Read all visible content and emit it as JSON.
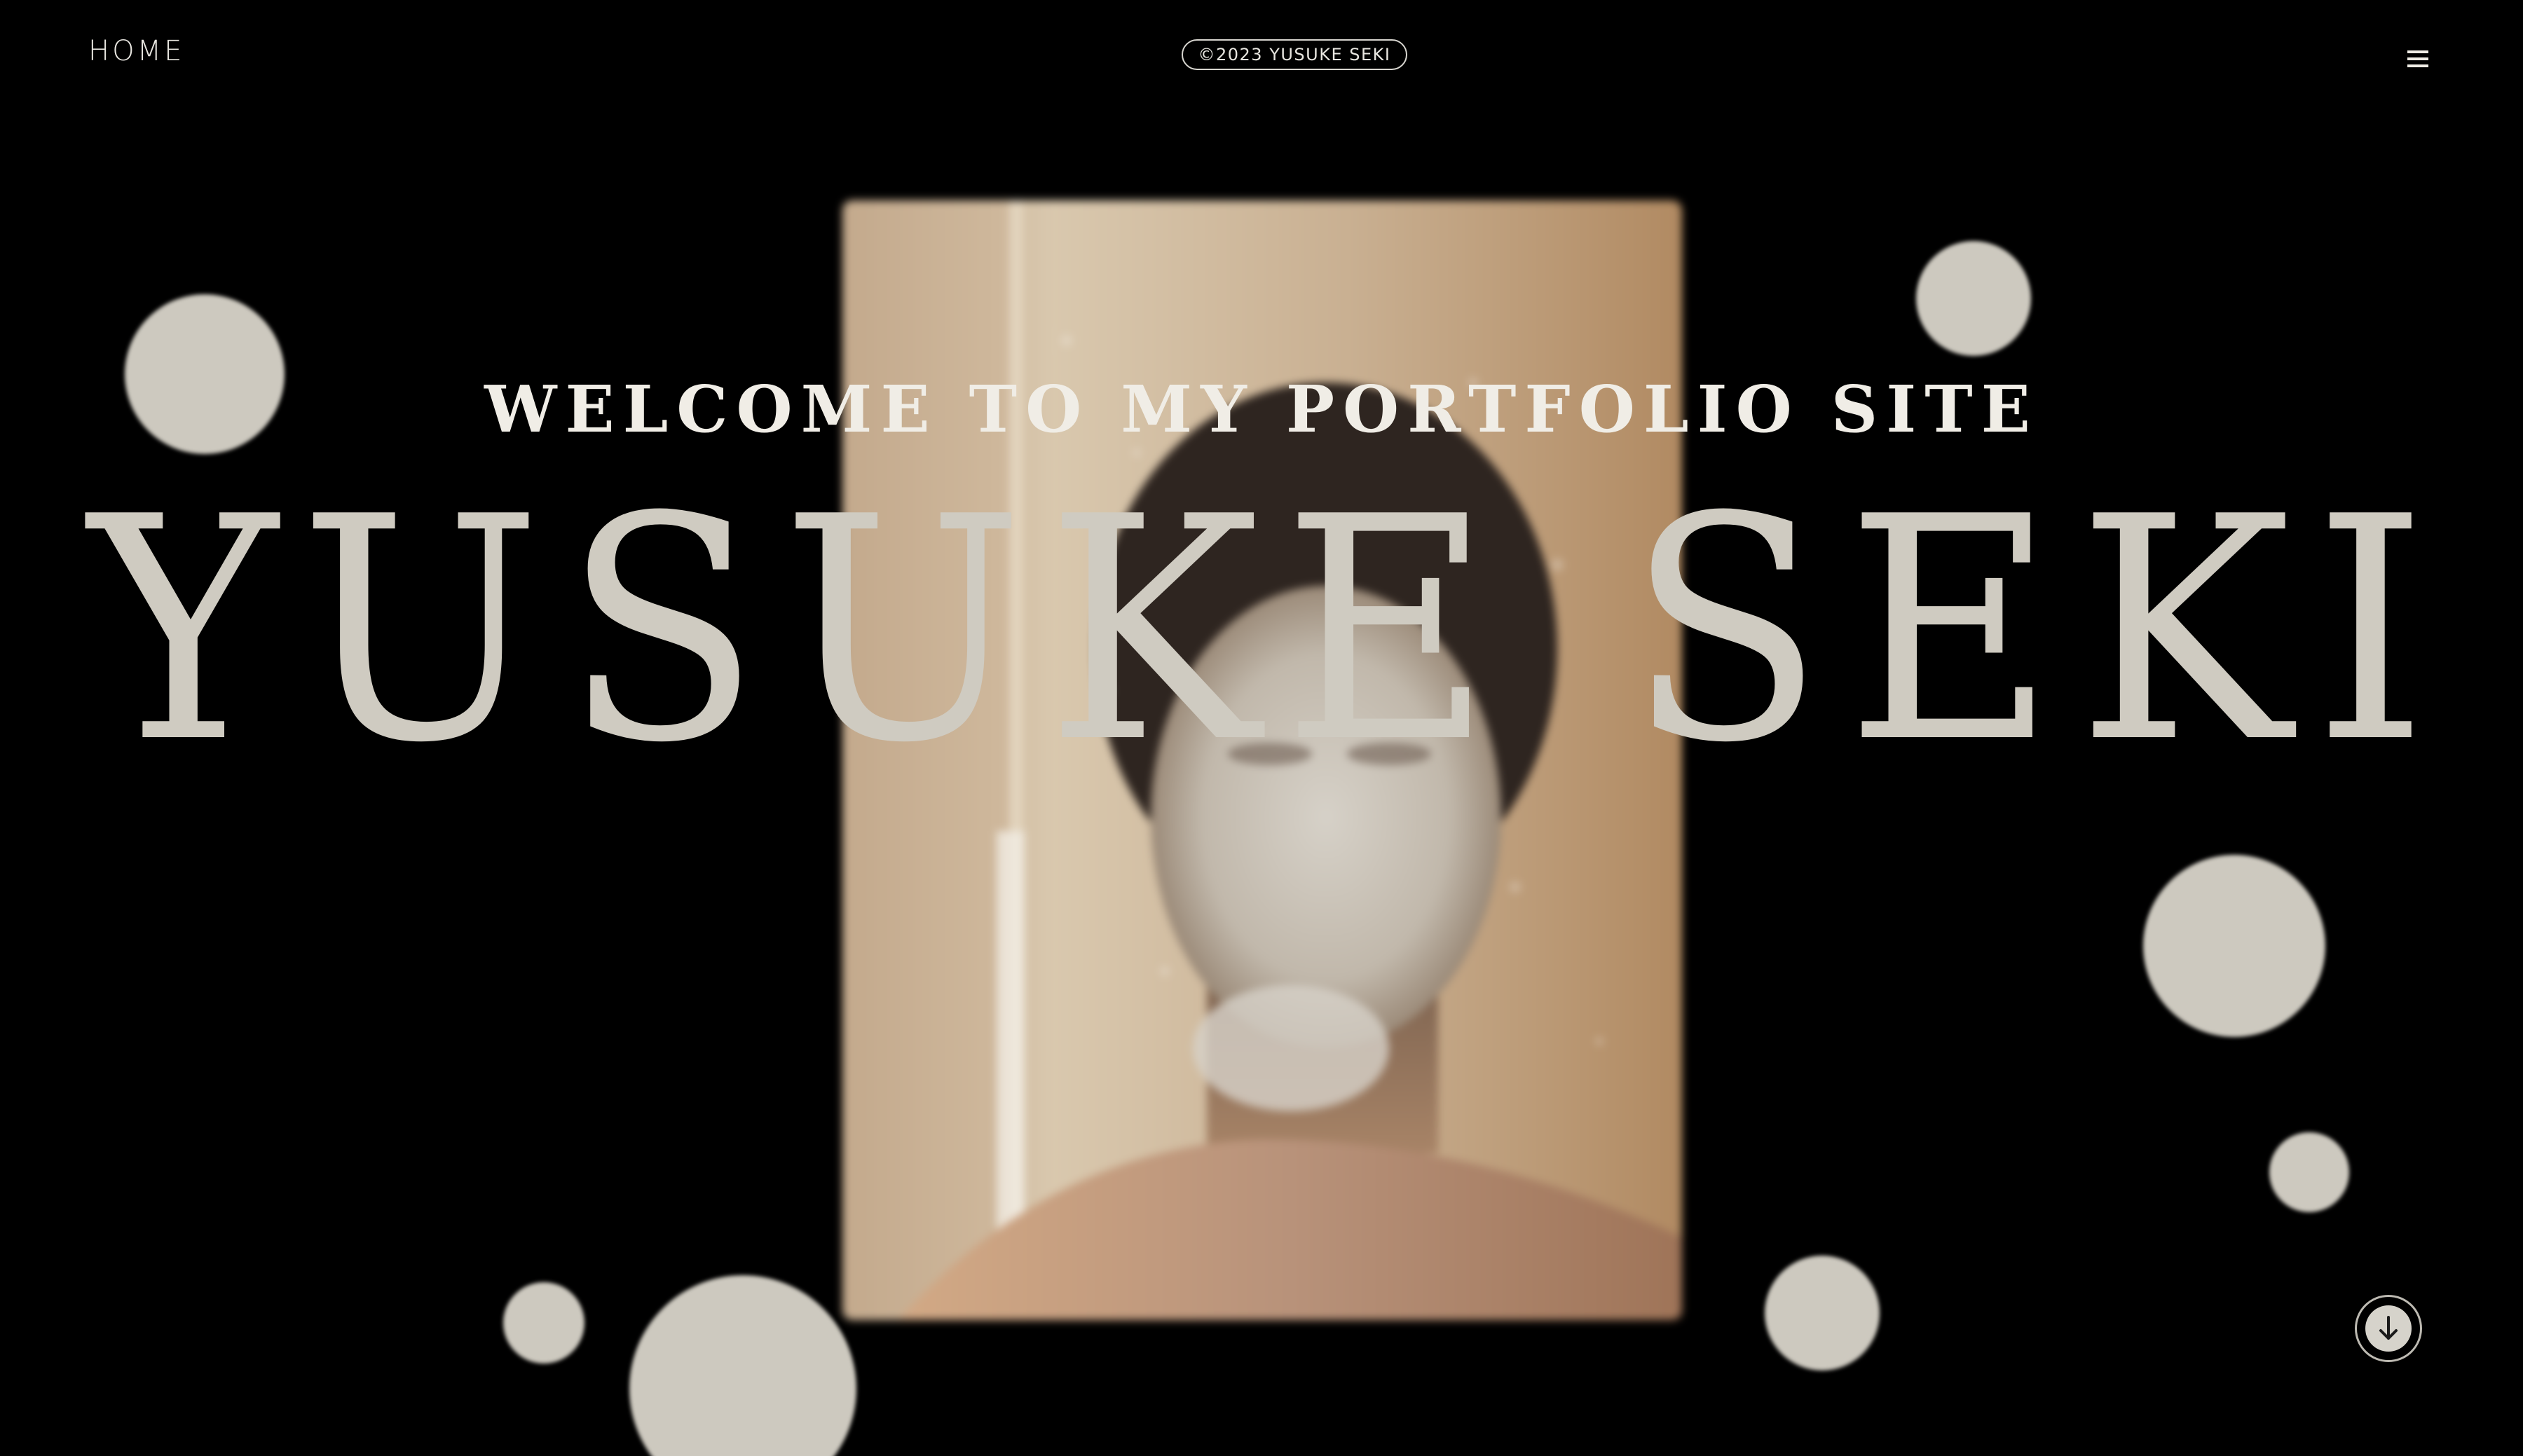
{
  "header": {
    "home_label": "HOME",
    "copyright": "©2023 YUSUKE SEKI",
    "menu_icon": "hamburger-menu-icon"
  },
  "hero": {
    "welcome": "WELCOME TO MY PORTFOLIO SITE",
    "name": "YUSUKE SEKI",
    "photo_description_icon": "portrait-photo"
  },
  "scroll_button": {
    "icon": "arrow-down-icon"
  },
  "colors": {
    "background": "#000000",
    "bubble": "#cdc9bf",
    "text_light": "#f0ede6",
    "name_text": "#cfcbc1"
  }
}
